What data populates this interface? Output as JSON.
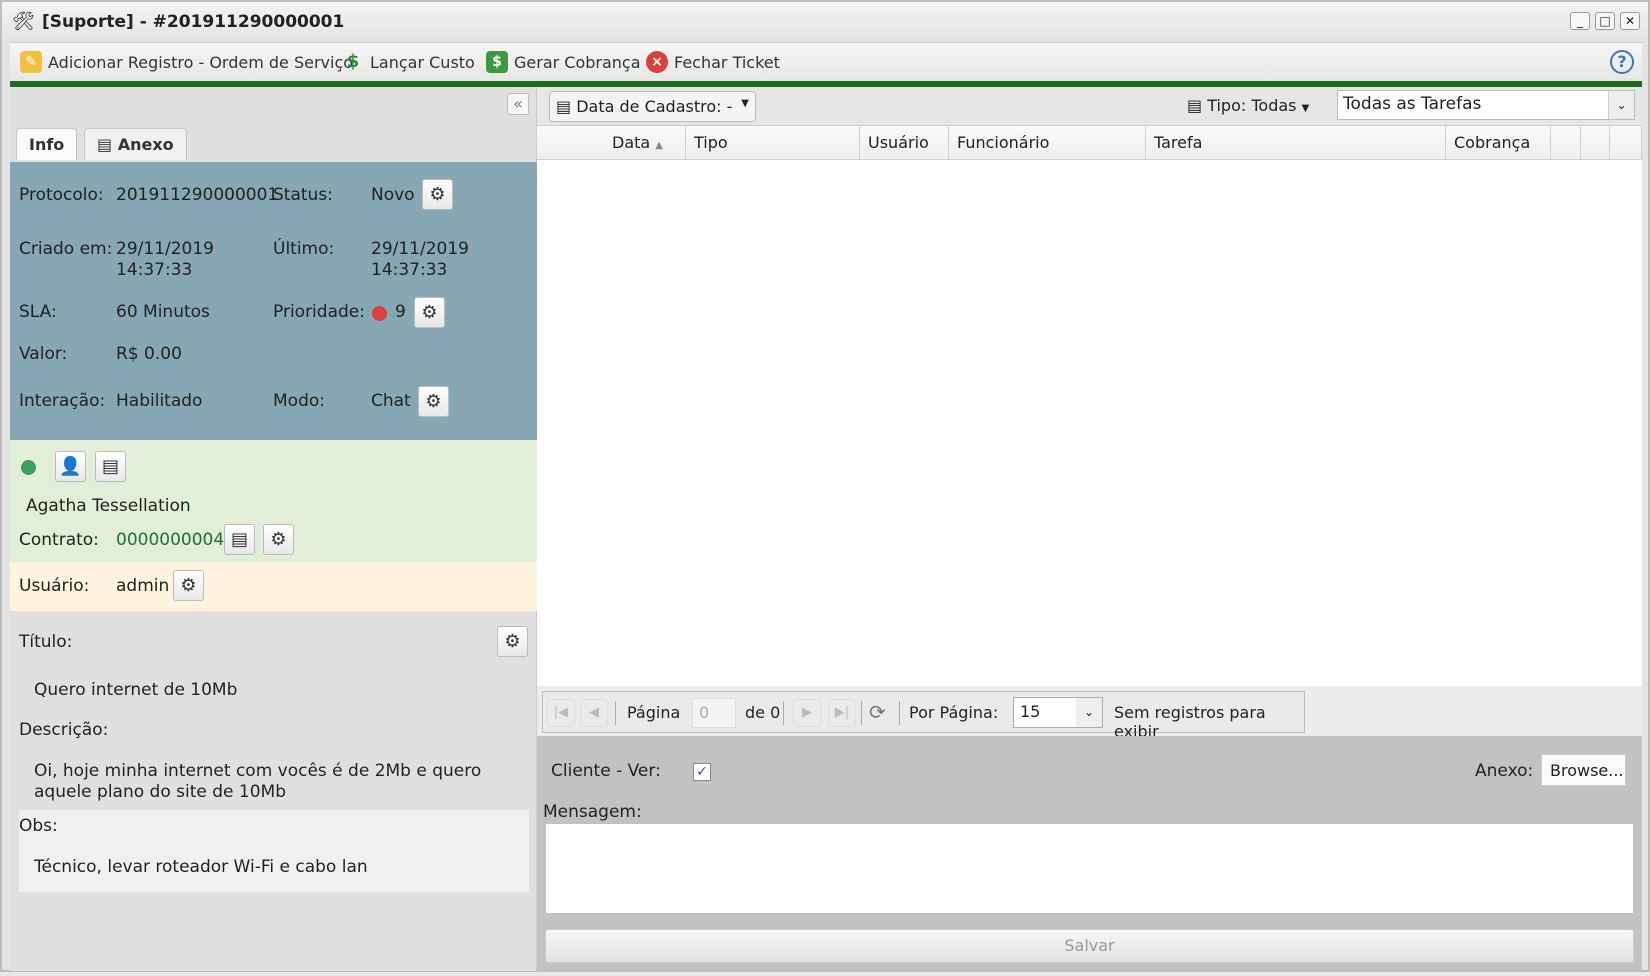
{
  "window": {
    "title": "[Suporte] - #201911290000001"
  },
  "toolbar": {
    "add_record": "Adicionar Registro - Ordem de Serviço",
    "cost": "Lançar Custo",
    "charge": "Gerar Cobrança",
    "close_ticket": "Fechar Ticket"
  },
  "tabs": {
    "info": "Info",
    "attachment": "Anexo"
  },
  "info": {
    "protocol_label": "Protocolo:",
    "protocol": "201911290000001",
    "status_label": "Status:",
    "status": "Novo",
    "created_label": "Criado em:",
    "created_date": "29/11/2019",
    "created_time": "14:37:33",
    "last_label": "Último:",
    "last_date": "29/11/2019",
    "last_time": "14:37:33",
    "sla_label": "SLA:",
    "sla": "60 Minutos",
    "priority_label": "Prioridade:",
    "priority": "9",
    "priority_color": "#d9413a",
    "value_label": "Valor:",
    "value": "R$ 0.00",
    "interaction_label": "Interação:",
    "interaction": "Habilitado",
    "mode_label": "Modo:",
    "mode": "Chat"
  },
  "client": {
    "status_color": "#3aa05a",
    "name": "Agatha Tessellation",
    "contract_label": "Contrato:",
    "contract": "0000000004"
  },
  "user": {
    "label": "Usuário:",
    "value": "admin"
  },
  "details": {
    "title_label": "Título:",
    "title": "Quero internet de 10Mb",
    "desc_label": "Descrição:",
    "desc": "Oi, hoje minha internet com vocês é de 2Mb e quero aquele plano do site de 10Mb",
    "obs_label": "Obs:",
    "obs": "Técnico, levar roteador Wi-Fi e cabo lan"
  },
  "filters": {
    "date": "Data de Cadastro: -",
    "type": "Tipo: Todas",
    "tasks": "Todas as Tarefas"
  },
  "grid": {
    "columns": [
      "Data",
      "Tipo",
      "Usuário",
      "Funcionário",
      "Tarefa",
      "Cobrança"
    ]
  },
  "paging": {
    "page_label": "Página",
    "page": "0",
    "of": "de 0",
    "per_page_label": "Por Página:",
    "per_page": "15",
    "empty": "Sem registros para exibir"
  },
  "form": {
    "client_view": "Cliente - Ver:",
    "attachment": "Anexo:",
    "browse": "Browse...",
    "message": "Mensagem:",
    "save": "Salvar"
  }
}
